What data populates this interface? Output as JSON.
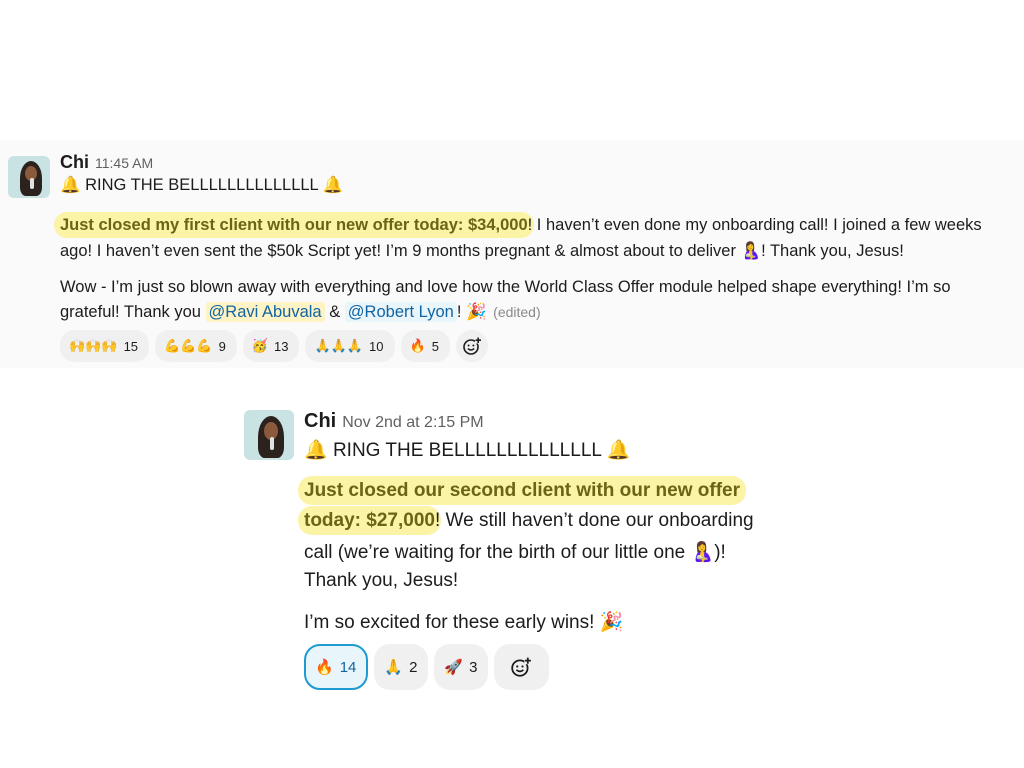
{
  "messages": [
    {
      "author": "Chi",
      "time": "11:45 AM",
      "line1_prefix": "🔔",
      "line1_text": " RING THE BELLLLLLLLLLLLLL ",
      "line1_suffix": "🔔",
      "para1_highlight": "Just closed my first client with our new offer today: $34,000",
      "para1_rest": "! I haven’t even done my onboarding call! I joined a few weeks",
      "para1_line2": "ago! I haven’t even sent the $50k Script yet! I’m 9 months pregnant & almost about to deliver ",
      "para1_line2_emoji": "🤱",
      "para1_line2_end": "! Thank you, Jesus!",
      "para2_line1": "Wow - I’m just so blown away with everything and love how the World Class Offer module helped shape everything! I’m so",
      "para2_line2_start": "grateful! Thank you ",
      "mention1": "@Ravi Abuvala",
      "amp": " & ",
      "mention2": "@Robert Lyon",
      "para2_end": "!",
      "party_emoji": "🎉",
      "edited": "(edited)",
      "reactions": [
        {
          "emoji": "🙌🙌🙌",
          "count": "15"
        },
        {
          "emoji": "💪💪💪",
          "count": "9"
        },
        {
          "emoji": "🥳",
          "count": "13"
        },
        {
          "emoji": "🙏🙏🙏",
          "count": "10"
        },
        {
          "emoji": "🔥",
          "count": "5"
        }
      ]
    },
    {
      "author": "Chi",
      "time": "Nov 2nd at 2:15 PM",
      "line1_prefix": "🔔",
      "line1_text": " RING THE BELLLLLLLLLLLLLL ",
      "line1_suffix": "🔔",
      "hl_line1": "Just closed our second client with our new offer",
      "hl_line2": "today: $27,000",
      "rest_line2": "! We still haven’t done our onboarding",
      "line3": "call (we’re waiting for the birth of our little one ",
      "line3_emoji": "🤱",
      "line3_end": ")!",
      "line4": "Thank you, Jesus!",
      "line5": "I’m so excited for these early wins! ",
      "line5_emoji": "🎉",
      "reactions": [
        {
          "emoji": "🔥",
          "count": "14",
          "selected": true
        },
        {
          "emoji": "🙏",
          "count": "2"
        },
        {
          "emoji": "🚀",
          "count": "3"
        }
      ]
    }
  ],
  "colors": {
    "highlight": "#fbf3a5",
    "highlight_text": "#6b6414",
    "mention_link": "#1264a3",
    "selected_reaction_border": "#1d9bd1"
  },
  "icons": {
    "add_reaction": "add-reaction-icon"
  }
}
